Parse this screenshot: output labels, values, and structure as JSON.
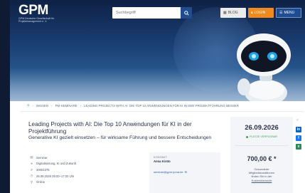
{
  "header": {
    "logo_text": "GPM",
    "logo_sub": "GPM Deutsche Gesellschaft für Projektmanagement e. V.",
    "search_placeholder": "Suchbegriff",
    "blog_label": "BLOG",
    "login_label": "LOGIN",
    "menu_label": "MENU"
  },
  "breadcrumb": {
    "items": [
      "WISSEN",
      "PM-SEMINARE",
      "LEADING PROJECTS WITH AI: DIE TOP 10 ANWENDUNGEN FÜR KI IN DER PROJEKTFÜHRUNG BESSER"
    ]
  },
  "event": {
    "title": "Leading Projects with AI: Die Top 10 Anwendungen für KI in der Projektführung",
    "subtitle": "Generative KI gezielt einsetzen – für wirksame Führung und bessere Entscheidungen",
    "info": [
      {
        "icon": "seminar-icon",
        "text": "Seminar"
      },
      {
        "icon": "tag-icon",
        "text": "Digitalisierung, KI und Zukunft"
      },
      {
        "icon": "id-icon",
        "text": "30001375"
      },
      {
        "icon": "clock-icon",
        "text": "26.09.2026 09:00–17:00 Uhr"
      },
      {
        "icon": "location-icon",
        "text": "Online"
      }
    ]
  },
  "contact": {
    "label": "KONTAKT",
    "name": "Anna Kirsto",
    "email": "seminar@gpm-ipma.de"
  },
  "booking": {
    "date": "26.09.2026",
    "availability": "PLÄTZE VERFÜGBAR",
    "price": "700,00 € *",
    "note_line1": "Gesonderte",
    "note_line2": "Mitgliedskonditionen",
    "note_line3": "finden Sie in der",
    "note_link": "Kostenübersicht"
  },
  "social": {
    "share_icon": "share-icon",
    "linkedin": "in",
    "facebook": "f",
    "xing": "x"
  },
  "colors": {
    "brand_blue": "#1f4d8f",
    "login_orange": "#f08a1c",
    "available_green": "#39a857"
  }
}
